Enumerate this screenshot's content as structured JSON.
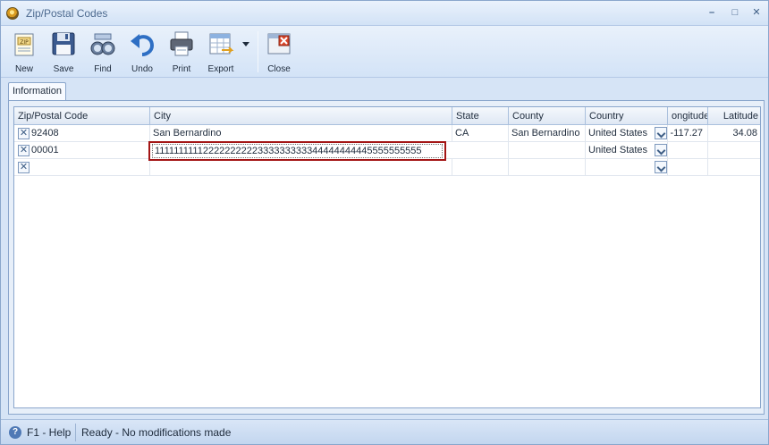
{
  "window": {
    "title": "Zip/Postal Codes",
    "minimize_glyph": "–",
    "maximize_glyph": "□",
    "close_glyph": "✕"
  },
  "toolbar": {
    "buttons": [
      {
        "label": "New",
        "icon": "new-document-icon"
      },
      {
        "label": "Save",
        "icon": "floppy-disk-icon"
      },
      {
        "label": "Find",
        "icon": "binoculars-icon"
      },
      {
        "label": "Undo",
        "icon": "undo-arrow-icon"
      },
      {
        "label": "Print",
        "icon": "printer-icon"
      },
      {
        "label": "Export",
        "icon": "export-table-icon"
      },
      {
        "label": "Close",
        "icon": "close-window-icon"
      }
    ]
  },
  "tabs": [
    {
      "label": "Information",
      "active": true
    }
  ],
  "grid": {
    "columns": [
      "Zip/Postal Code",
      "City",
      "State",
      "County",
      "Country",
      "ongitude",
      "Latitude"
    ],
    "rows": [
      {
        "zip": "92408",
        "city": "San Bernardino",
        "state": "CA",
        "county": "San Bernardino",
        "country": "United States",
        "longitude": "-117.27",
        "latitude": "34.08"
      },
      {
        "zip": "00001",
        "city": "11111111112222222222333333333344444444445555555555",
        "state": "",
        "county": "",
        "country": "United States",
        "longitude": "",
        "latitude": ""
      },
      {
        "zip": "",
        "city": "",
        "state": "",
        "county": "",
        "country": "",
        "longitude": "",
        "latitude": ""
      }
    ],
    "delete_glyph": "✕"
  },
  "statusbar": {
    "help": "F1 - Help",
    "help_glyph": "?",
    "message": "Ready - No modifications made"
  },
  "colors": {
    "accent": "#4f79b5",
    "edit_border": "#a31515",
    "chrome": "#d6e4f6"
  }
}
